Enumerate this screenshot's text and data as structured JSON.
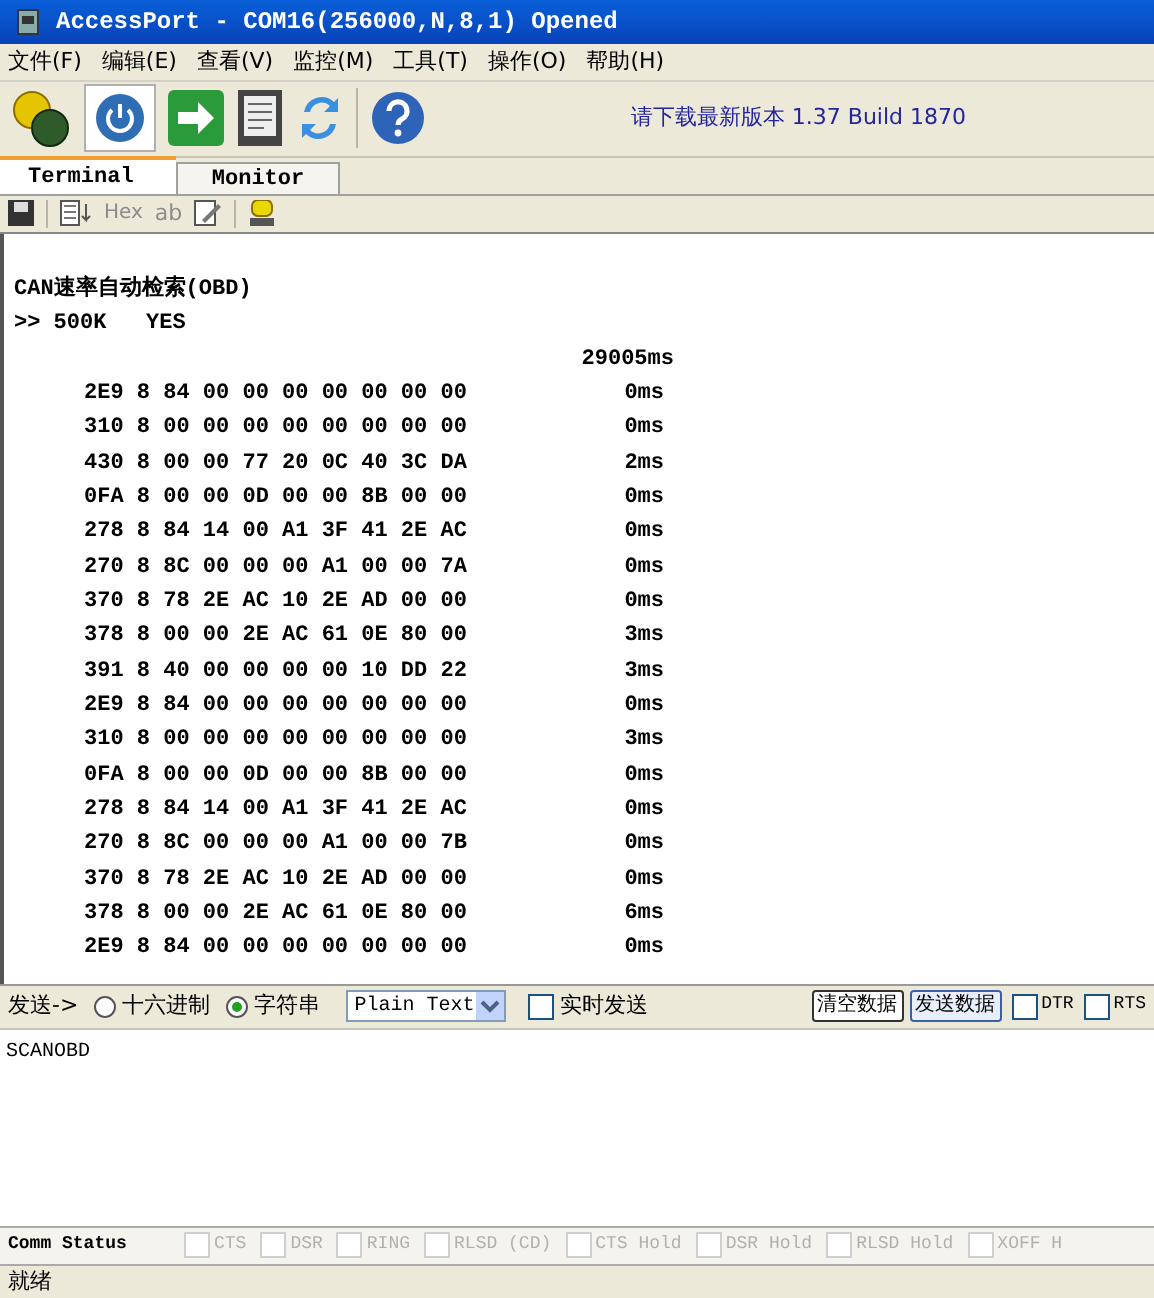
{
  "window": {
    "title": "AccessPort - COM16(256000,N,8,1) Opened"
  },
  "menu": [
    "文件(F)",
    "编辑(E)",
    "查看(V)",
    "监控(M)",
    "工具(T)",
    "操作(O)",
    "帮助(H)"
  ],
  "update_notice": "请下载最新版本 1.37 Build 1870",
  "tabs": [
    {
      "label": "Terminal",
      "selected": true
    },
    {
      "label": "Monitor",
      "selected": false
    }
  ],
  "sub_toolbar": {
    "hex_label": "Hex",
    "ab_label": "ab",
    "disabled": true
  },
  "terminal": {
    "heading": "CAN速率自动检索(OBD)",
    "result": ">> 500K   YES",
    "total_time": "29005ms",
    "rows": [
      {
        "data": "2E9 8 84 00 00 00 00 00 00 00",
        "time": "0ms"
      },
      {
        "data": "310 8 00 00 00 00 00 00 00 00",
        "time": "0ms"
      },
      {
        "data": "430 8 00 00 77 20 0C 40 3C DA",
        "time": "2ms"
      },
      {
        "data": "0FA 8 00 00 0D 00 00 8B 00 00",
        "time": "0ms"
      },
      {
        "data": "278 8 84 14 00 A1 3F 41 2E AC",
        "time": "0ms"
      },
      {
        "data": "270 8 8C 00 00 00 A1 00 00 7A",
        "time": "0ms"
      },
      {
        "data": "370 8 78 2E AC 10 2E AD 00 00",
        "time": "0ms"
      },
      {
        "data": "378 8 00 00 2E AC 61 0E 80 00",
        "time": "3ms"
      },
      {
        "data": "391 8 40 00 00 00 00 10 DD 22",
        "time": "3ms"
      },
      {
        "data": "2E9 8 84 00 00 00 00 00 00 00",
        "time": "0ms"
      },
      {
        "data": "310 8 00 00 00 00 00 00 00 00",
        "time": "3ms"
      },
      {
        "data": "0FA 8 00 00 0D 00 00 8B 00 00",
        "time": "0ms"
      },
      {
        "data": "278 8 84 14 00 A1 3F 41 2E AC",
        "time": "0ms"
      },
      {
        "data": "270 8 8C 00 00 00 A1 00 00 7B",
        "time": "0ms"
      },
      {
        "data": "370 8 78 2E AC 10 2E AD 00 00",
        "time": "0ms"
      },
      {
        "data": "378 8 00 00 2E AC 61 0E 80 00",
        "time": "6ms"
      },
      {
        "data": "2E9 8 84 00 00 00 00 00 00 00",
        "time": "0ms"
      }
    ]
  },
  "send_bar": {
    "label": "发送->",
    "modes": [
      {
        "label": "十六进制",
        "selected": false
      },
      {
        "label": "字符串",
        "selected": true
      }
    ],
    "format": "Plain Text",
    "realtime": {
      "label": "实时发送",
      "checked": false
    },
    "buttons": [
      {
        "label": "清空数据",
        "focused": false
      },
      {
        "label": "发送数据",
        "focused": true
      }
    ],
    "lines": [
      {
        "label": "DTR",
        "checked": false
      },
      {
        "label": "RTS",
        "checked": false
      }
    ]
  },
  "send_text": "SCANOBD",
  "comm_status": {
    "label": "Comm Status",
    "items": [
      {
        "label": "CTS",
        "checked": false
      },
      {
        "label": "DSR",
        "checked": false
      },
      {
        "label": "RING",
        "checked": false
      },
      {
        "label": "RLSD (CD)",
        "checked": false
      },
      {
        "label": "CTS Hold",
        "checked": false
      },
      {
        "label": "DSR Hold",
        "checked": false
      },
      {
        "label": "RLSD Hold",
        "checked": false
      },
      {
        "label": "XOFF H",
        "checked": false
      }
    ]
  },
  "status_bar": "就绪"
}
